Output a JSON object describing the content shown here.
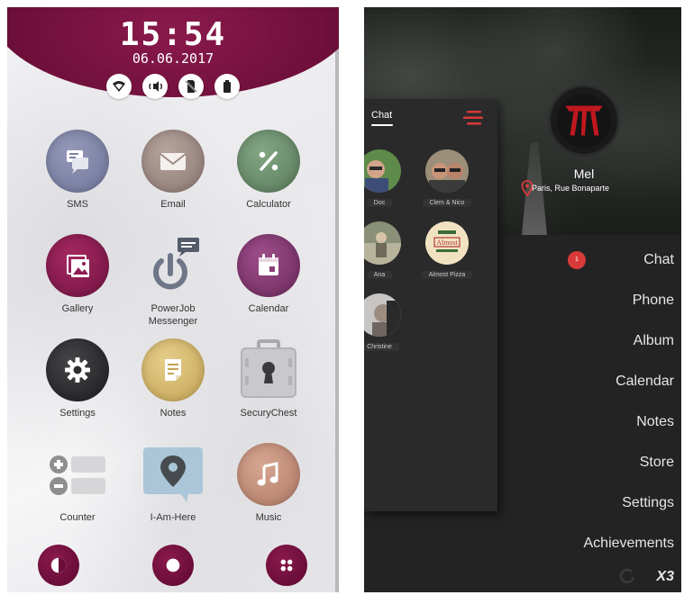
{
  "left_screen": {
    "time": "15:54",
    "date": "06.06.2017",
    "status_icons": [
      "wifi-icon",
      "sound-icon",
      "no-sim-icon",
      "battery-icon"
    ],
    "apps": [
      {
        "label": "SMS",
        "icon": "sms-icon",
        "color": "#7d82a6"
      },
      {
        "label": "Email",
        "icon": "email-icon",
        "color": "#a08c86"
      },
      {
        "label": "Calculator",
        "icon": "calculator-icon",
        "color": "#6d8f6e"
      },
      {
        "label": "Gallery",
        "icon": "gallery-icon",
        "color": "#8d1d52"
      },
      {
        "label": "PowerJob\nMessenger",
        "icon": "powerjob-icon",
        "color": "#6e7687"
      },
      {
        "label": "Calendar",
        "icon": "calendar-icon",
        "color": "#8a3d77"
      },
      {
        "label": "Settings",
        "icon": "settings-icon",
        "color": "#2e2e30"
      },
      {
        "label": "Notes",
        "icon": "notes-icon",
        "color": "#d6b96e"
      },
      {
        "label": "SecuryChest",
        "icon": "chest-icon",
        "color": "#c8c8c8"
      },
      {
        "label": "Counter",
        "icon": "counter-icon",
        "color": "#d8d8da"
      },
      {
        "label": "I-Am-Here",
        "icon": "location-icon",
        "color": "#a9c4d6"
      },
      {
        "label": "Music",
        "icon": "music-icon",
        "color": "#c4907c"
      }
    ],
    "dock": [
      "moon-icon",
      "home-icon",
      "apps-icon"
    ],
    "accent": "#6e0f3a"
  },
  "right_screen": {
    "profile": {
      "name": "Mel",
      "location": "Paris, Rue Bonaparte"
    },
    "chat_panel": {
      "title": "Chat",
      "contacts": [
        {
          "name": "Doc"
        },
        {
          "name": "Clem & Nico"
        },
        {
          "name": "Ana"
        },
        {
          "name": "Almost Pizza"
        },
        {
          "name": "Christine"
        }
      ]
    },
    "menu": [
      {
        "label": "Chat",
        "badge": "1"
      },
      {
        "label": "Phone"
      },
      {
        "label": "Album"
      },
      {
        "label": "Calendar"
      },
      {
        "label": "Notes"
      },
      {
        "label": "Store"
      },
      {
        "label": "Settings"
      },
      {
        "label": "Achievements"
      }
    ],
    "brand": "X3",
    "accent": "#d83a3a"
  }
}
